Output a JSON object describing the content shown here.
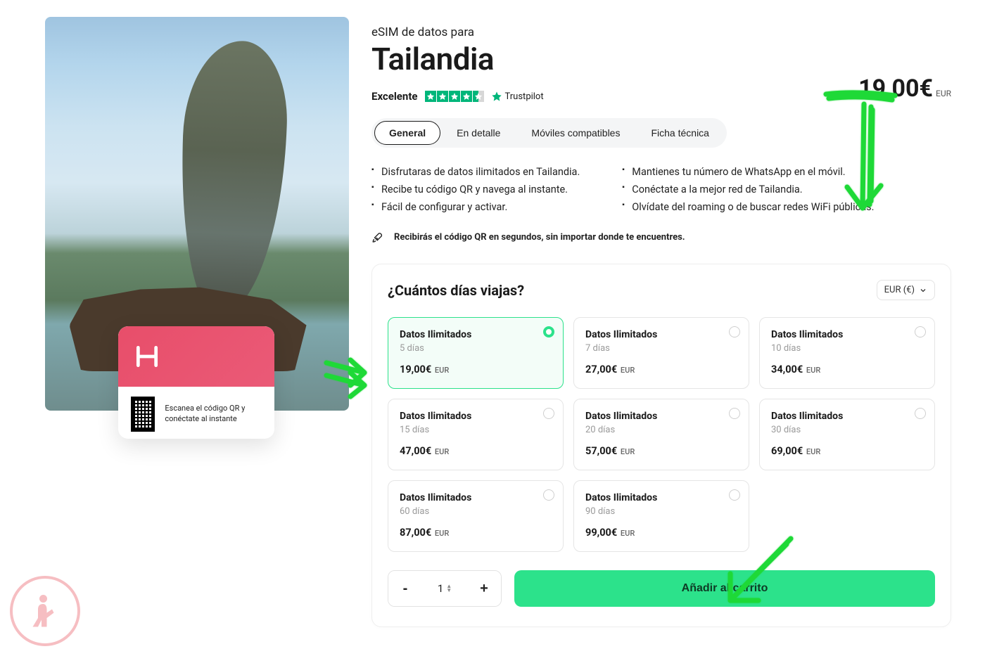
{
  "pre_title": "eSIM de datos para",
  "title": "Tailandia",
  "rating_label": "Excelente",
  "trustpilot_label": "Trustpilot",
  "price_top": {
    "amount": "19,00€",
    "currency": "EUR"
  },
  "tabs": {
    "general": "General",
    "detail": "En detalle",
    "compat": "Móviles compatibles",
    "tech": "Ficha técnica"
  },
  "features_left": [
    "Disfrutaras de datos ilimitados en Tailandia.",
    "Recibe tu código QR y navega al instante.",
    "Fácil de configurar y activar."
  ],
  "features_right": [
    "Mantienes tu número de WhatsApp en el móvil.",
    "Conéctate a la mejor red de Tailandia.",
    "Olvídate del roaming o de buscar redes WiFi públicas."
  ],
  "qr_note": "Recibirás el código QR en segundos, sin importar donde te encuentres.",
  "qr_card_text": "Escanea el código QR y conéctate al instante",
  "plan": {
    "heading": "¿Cuántos días viajas?",
    "currency_select": "EUR (€)",
    "cards": [
      {
        "name": "Datos Ilimitados",
        "days": "5 días",
        "price": "19,00€",
        "cur": "EUR",
        "selected": true
      },
      {
        "name": "Datos Ilimitados",
        "days": "7 días",
        "price": "27,00€",
        "cur": "EUR",
        "selected": false
      },
      {
        "name": "Datos Ilimitados",
        "days": "10 días",
        "price": "34,00€",
        "cur": "EUR",
        "selected": false
      },
      {
        "name": "Datos Ilimitados",
        "days": "15 días",
        "price": "47,00€",
        "cur": "EUR",
        "selected": false
      },
      {
        "name": "Datos Ilimitados",
        "days": "20 días",
        "price": "57,00€",
        "cur": "EUR",
        "selected": false
      },
      {
        "name": "Datos Ilimitados",
        "days": "30 días",
        "price": "69,00€",
        "cur": "EUR",
        "selected": false
      },
      {
        "name": "Datos Ilimitados",
        "days": "60 días",
        "price": "87,00€",
        "cur": "EUR",
        "selected": false
      },
      {
        "name": "Datos Ilimitados",
        "days": "90 días",
        "price": "99,00€",
        "cur": "EUR",
        "selected": false
      }
    ],
    "quantity": "1",
    "add_to_cart": "Añadir al carrito"
  }
}
